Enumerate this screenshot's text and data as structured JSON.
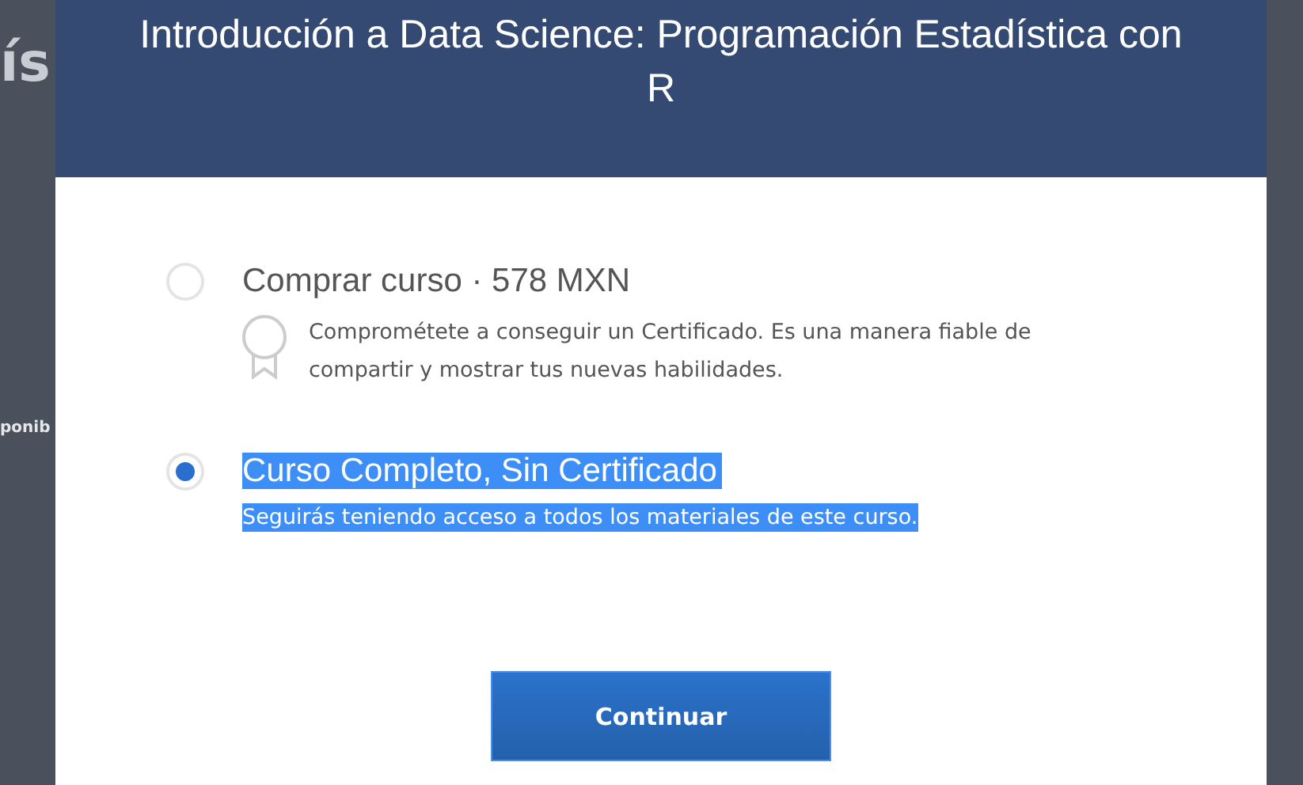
{
  "background": {
    "texts": [
      "ís",
      "ponib"
    ]
  },
  "dialog": {
    "title": "Introducción a Data Science: Programación Estadística con R",
    "options": [
      {
        "label": "Comprar curso · 578 MXN",
        "description": "Comprométete a conseguir un Certificado. Es una manera fiable de compartir y mostrar tus nuevas habilidades.",
        "kind": "certificate",
        "selected": false,
        "highlighted": false
      },
      {
        "label": "Curso Completo, Sin Certificado",
        "description": "Seguirás teniendo acceso a todos los materiales de este curso.",
        "kind": "plain",
        "selected": true,
        "highlighted": true
      }
    ],
    "button": "Continuar"
  }
}
